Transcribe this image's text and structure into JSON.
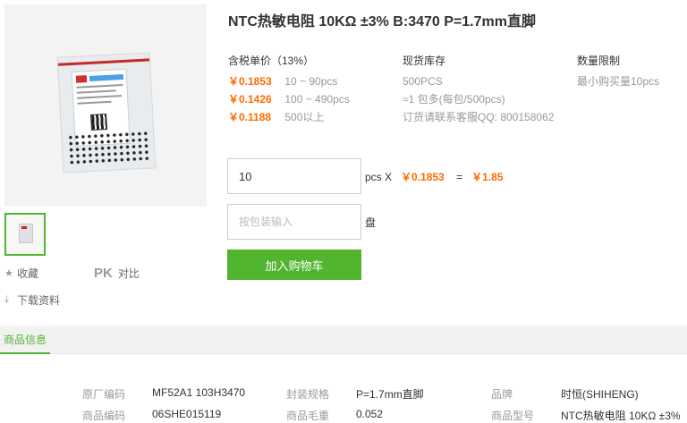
{
  "product": {
    "title": "NTC热敏电阻 10KΩ ±3% B:3470 P=1.7mm直脚"
  },
  "gallery": {
    "main_image_alt": "product-image",
    "thumbnail_alt": "thumbnail"
  },
  "side_actions": {
    "favorite_label": "收藏",
    "pk_label": "PK",
    "compare_label": "对比",
    "download_label": "下载资料"
  },
  "pricing": {
    "header": "含税单价（13%）",
    "tiers": [
      {
        "price": "￥0.1853",
        "range": "10 ~ 90pcs"
      },
      {
        "price": "￥0.1426",
        "range": "100 ~ 490pcs"
      },
      {
        "price": "￥0.1188",
        "range": "500以上"
      }
    ]
  },
  "stock": {
    "header": "现货库存",
    "lines": [
      "500PCS",
      "≈1 包多(每包/500pcs)",
      "订货请联系客服QQ: 800158062"
    ]
  },
  "limit": {
    "header": "数量限制",
    "text": "最小购买量10pcs"
  },
  "order": {
    "quantity_value": "10",
    "pcs_unit": "pcs X",
    "unit_price": "￥0.1853",
    "equals": "=",
    "total": "￥1.85",
    "pack_placeholder": "按包装输入",
    "pack_unit": "盘",
    "add_to_cart": "加入购物车"
  },
  "tabs": {
    "product_info": "商品信息"
  },
  "specs": {
    "row1": [
      {
        "key": "原厂编码",
        "value": "MF52A1 103H3470"
      },
      {
        "key": "封装规格",
        "value": "P=1.7mm直脚"
      },
      {
        "key": "品牌",
        "value": "时恒(SHIHENG)"
      }
    ],
    "row2": [
      {
        "key": "商品编码",
        "value": "06SHE015119"
      },
      {
        "key": "商品毛重",
        "value": "0.052"
      },
      {
        "key": "商品型号",
        "value": "NTC热敏电阻 10KΩ ±3%"
      }
    ]
  },
  "colors": {
    "accent_green": "#52b530",
    "price_orange": "#ff6a00"
  }
}
